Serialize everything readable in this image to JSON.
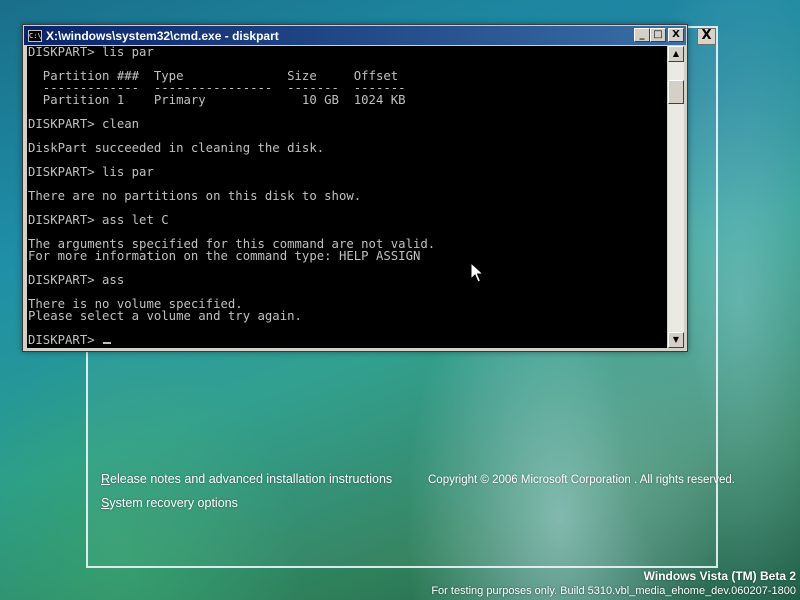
{
  "setup": {
    "close_label": "X",
    "links": {
      "release_first": "R",
      "release_rest": "elease notes and advanced installation instructions",
      "recovery_first": "S",
      "recovery_rest": "ystem recovery options"
    },
    "copyright": "Copyright © 2006 Microsoft Corporation . All rights reserved."
  },
  "cmd": {
    "icon_text": "C:\\",
    "title": "X:\\windows\\system32\\cmd.exe - diskpart",
    "controls": {
      "minimize": "_",
      "maximize": "□",
      "close": "X"
    },
    "scroll": {
      "up": "▲",
      "down": "▼"
    },
    "console_text": "DISKPART> lis par\n\n  Partition ###  Type              Size     Offset\n  -------------  ----------------  -------  -------\n  Partition 1    Primary             10 GB  1024 KB\n\nDISKPART> clean\n\nDiskPart succeeded in cleaning the disk.\n\nDISKPART> lis par\n\nThere are no partitions on this disk to show.\n\nDISKPART> ass let C\n\nThe arguments specified for this command are not valid.\nFor more information on the command type: HELP ASSIGN\n\nDISKPART> ass\n\nThere is no volume specified.\nPlease select a volume and try again.\n\nDISKPART> "
  },
  "watermark": {
    "title": "Windows Vista (TM) Beta 2",
    "build": "For testing purposes only. Build 5310.vbl_media_ehome_dev.060207-1800"
  },
  "icons": {
    "cmd": "cmd-icon",
    "pointer": "mouse-pointer-icon"
  }
}
